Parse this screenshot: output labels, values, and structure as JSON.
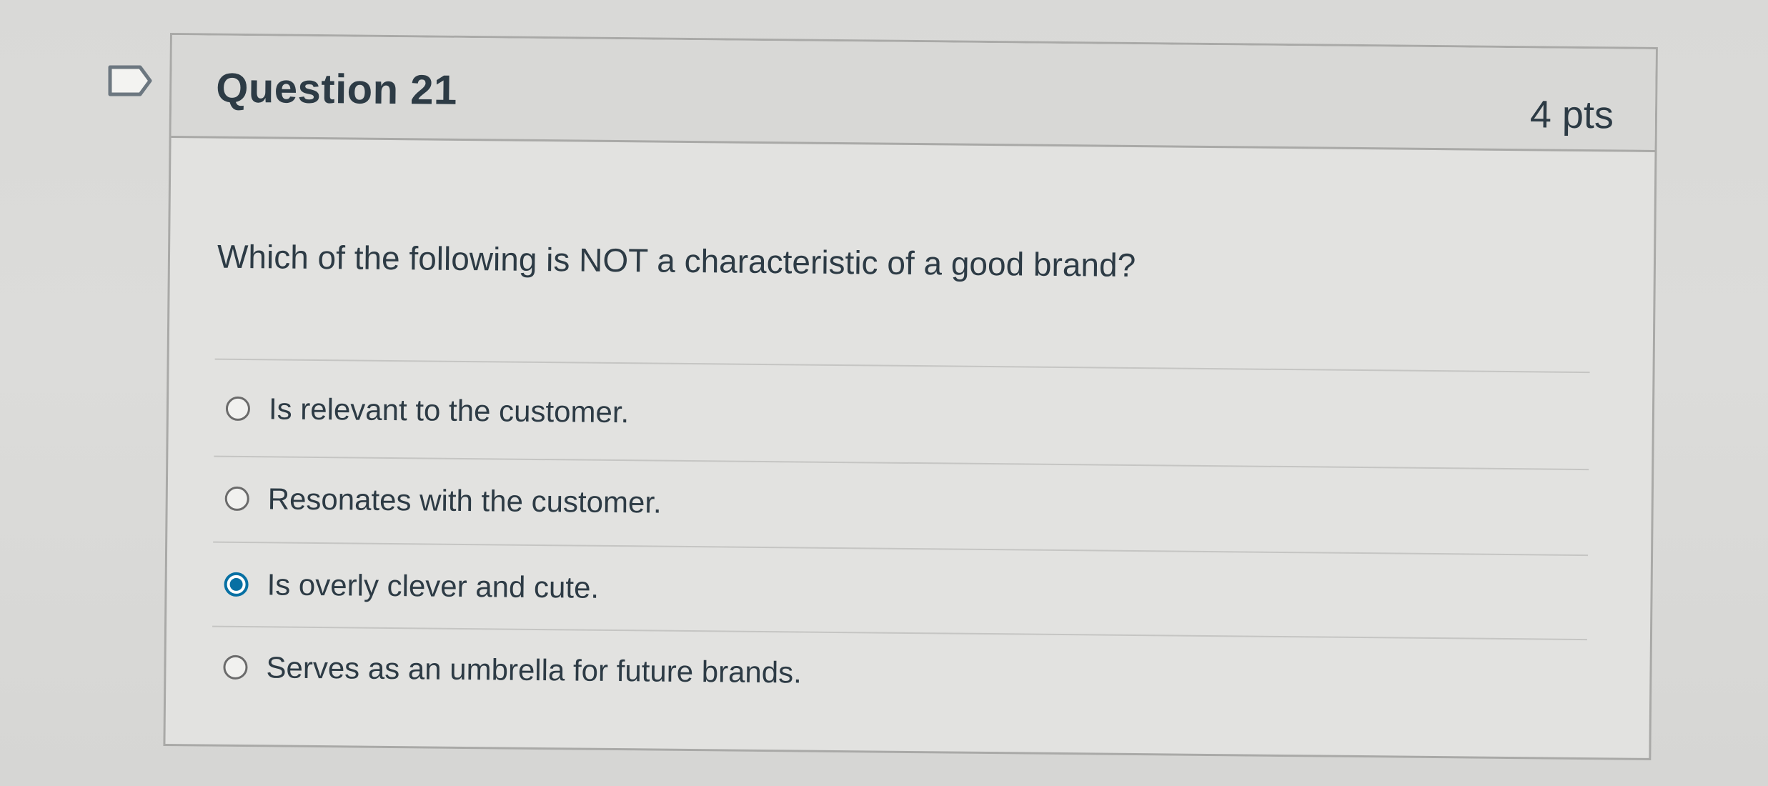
{
  "question": {
    "title": "Question 21",
    "points": "4 pts",
    "text": "Which of the following is NOT a characteristic of a good brand?",
    "answers": [
      {
        "label": "Is relevant to the customer.",
        "selected": false
      },
      {
        "label": "Resonates with the customer.",
        "selected": false
      },
      {
        "label": "Is overly clever and cute.",
        "selected": true
      },
      {
        "label": "Serves as an umbrella for future brands.",
        "selected": false
      }
    ]
  },
  "icons": {
    "flag": "flag-outline-icon"
  },
  "colors": {
    "selected_radio": "#0770a3",
    "text": "#2d3b45",
    "border": "#a9a9a7"
  }
}
